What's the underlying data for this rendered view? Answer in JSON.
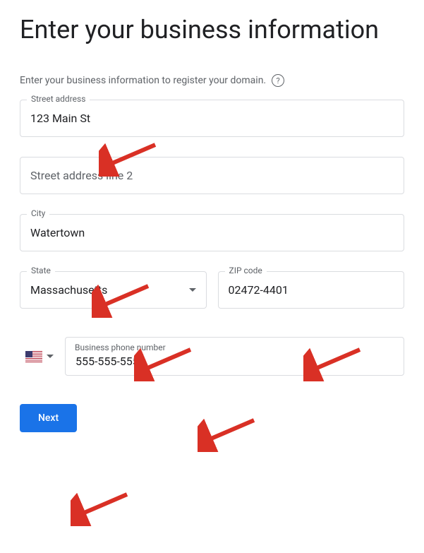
{
  "title": "Enter your business information",
  "subtitle": "Enter your business information to register your domain.",
  "fields": {
    "street_address": {
      "label": "Street address",
      "value": "123 Main St"
    },
    "street_address_2": {
      "placeholder": "Street address line 2",
      "value": ""
    },
    "city": {
      "label": "City",
      "value": "Watertown"
    },
    "state": {
      "label": "State",
      "value": "Massachusetts"
    },
    "zip": {
      "label": "ZIP code",
      "value": "02472-4401"
    },
    "phone": {
      "label": "Business phone number",
      "value": "555-555-5555",
      "country": "US"
    }
  },
  "buttons": {
    "next": "Next"
  },
  "icons": {
    "help": "?"
  }
}
